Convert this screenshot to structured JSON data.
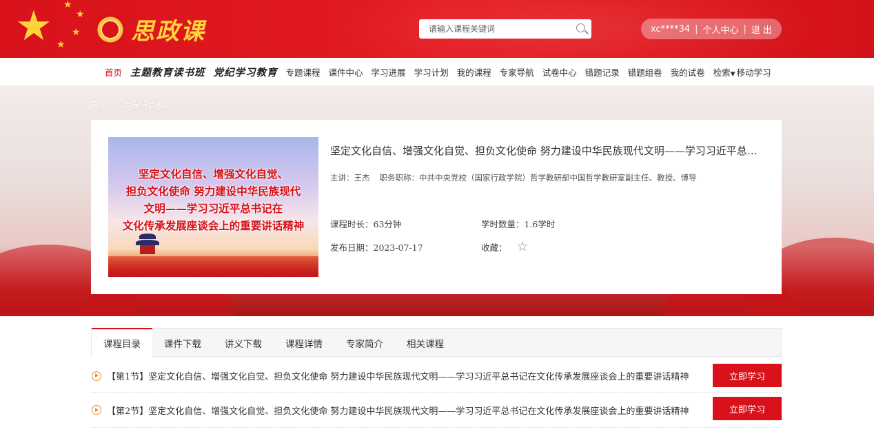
{
  "brand": {
    "logo_text": "思政课"
  },
  "search": {
    "placeholder": "请输入课程关键词"
  },
  "user": {
    "name": "xc****34",
    "center": "个人中心",
    "logout": "退 出"
  },
  "nav": {
    "items": [
      {
        "label": "首页",
        "active": true
      },
      {
        "label": "主题教育读书班"
      },
      {
        "label": "党纪学习教育"
      },
      {
        "label": "专题课程"
      },
      {
        "label": "课件中心"
      },
      {
        "label": "学习进展"
      },
      {
        "label": "学习计划"
      },
      {
        "label": "我的课程"
      },
      {
        "label": "专家导航"
      },
      {
        "label": "试卷中心"
      },
      {
        "label": "错题记录"
      },
      {
        "label": "错题组卷"
      },
      {
        "label": "我的试卷"
      },
      {
        "label": "检索"
      },
      {
        "label": "移动学习"
      }
    ]
  },
  "breadcrumb": {
    "home": "首页",
    "sep": "/",
    "current": "课程信息概览"
  },
  "course": {
    "poster_lines": [
      "坚定文化自信、增强文化自觉、",
      "担负文化使命 努力建设中华民族现代",
      "文明——学习习近平总书记在",
      "文化传承发展座谈会上的重要讲话精神"
    ],
    "title": "坚定文化自信、增强文化自觉、担负文化使命 努力建设中华民族现代文明——学习习近平总书记在文化传承发展座谈会上的重要讲话精神",
    "teacher_label": "主讲：王杰",
    "position": "职务职称：中共中央党校（国家行政学院）哲学教研部中国哲学教研室副主任、教授、博导",
    "duration": "课程时长：63分钟",
    "credits": "学时数量：1.6学时",
    "date": "发布日期：2023-07-17",
    "favorite_label": "收藏："
  },
  "tabs": [
    {
      "label": "课程目录",
      "active": true
    },
    {
      "label": "课件下载"
    },
    {
      "label": "讲义下载"
    },
    {
      "label": "课程详情"
    },
    {
      "label": "专家简介"
    },
    {
      "label": "相关课程"
    }
  ],
  "lessons": [
    {
      "name": "【第1节】坚定文化自信、增强文化自觉、担负文化使命 努力建设中华民族现代文明——学习习近平总书记在文化传承发展座谈会上的重要讲话精神",
      "button": "立即学习"
    },
    {
      "name": "【第2节】坚定文化自信、增强文化自觉、担负文化使命 努力建设中华民族现代文明——学习习近平总书记在文化传承发展座谈会上的重要讲话精神",
      "button": "立即学习"
    }
  ],
  "colors": {
    "primary": "#d8111b",
    "gold": "#ffd43a",
    "play": "#e8902d"
  }
}
